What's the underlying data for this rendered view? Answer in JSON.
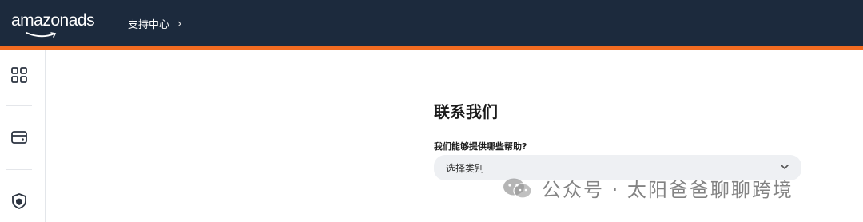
{
  "header": {
    "logo_text": "amazonads",
    "breadcrumb": "支持中心"
  },
  "sidebar": {
    "items": [
      {
        "icon": "dashboard-grid-icon"
      },
      {
        "icon": "wallet-icon"
      },
      {
        "icon": "shield-icon"
      }
    ]
  },
  "main": {
    "title": "联系我们",
    "question": "我们能够提供哪些帮助?",
    "select": {
      "value": "选择类别"
    }
  },
  "watermark": {
    "text": "公众号 · 太阳爸爸聊聊跨境"
  },
  "colors": {
    "header_bg": "#1c2a3d",
    "accent": "#f26b21",
    "select_bg": "#eef0f3"
  }
}
